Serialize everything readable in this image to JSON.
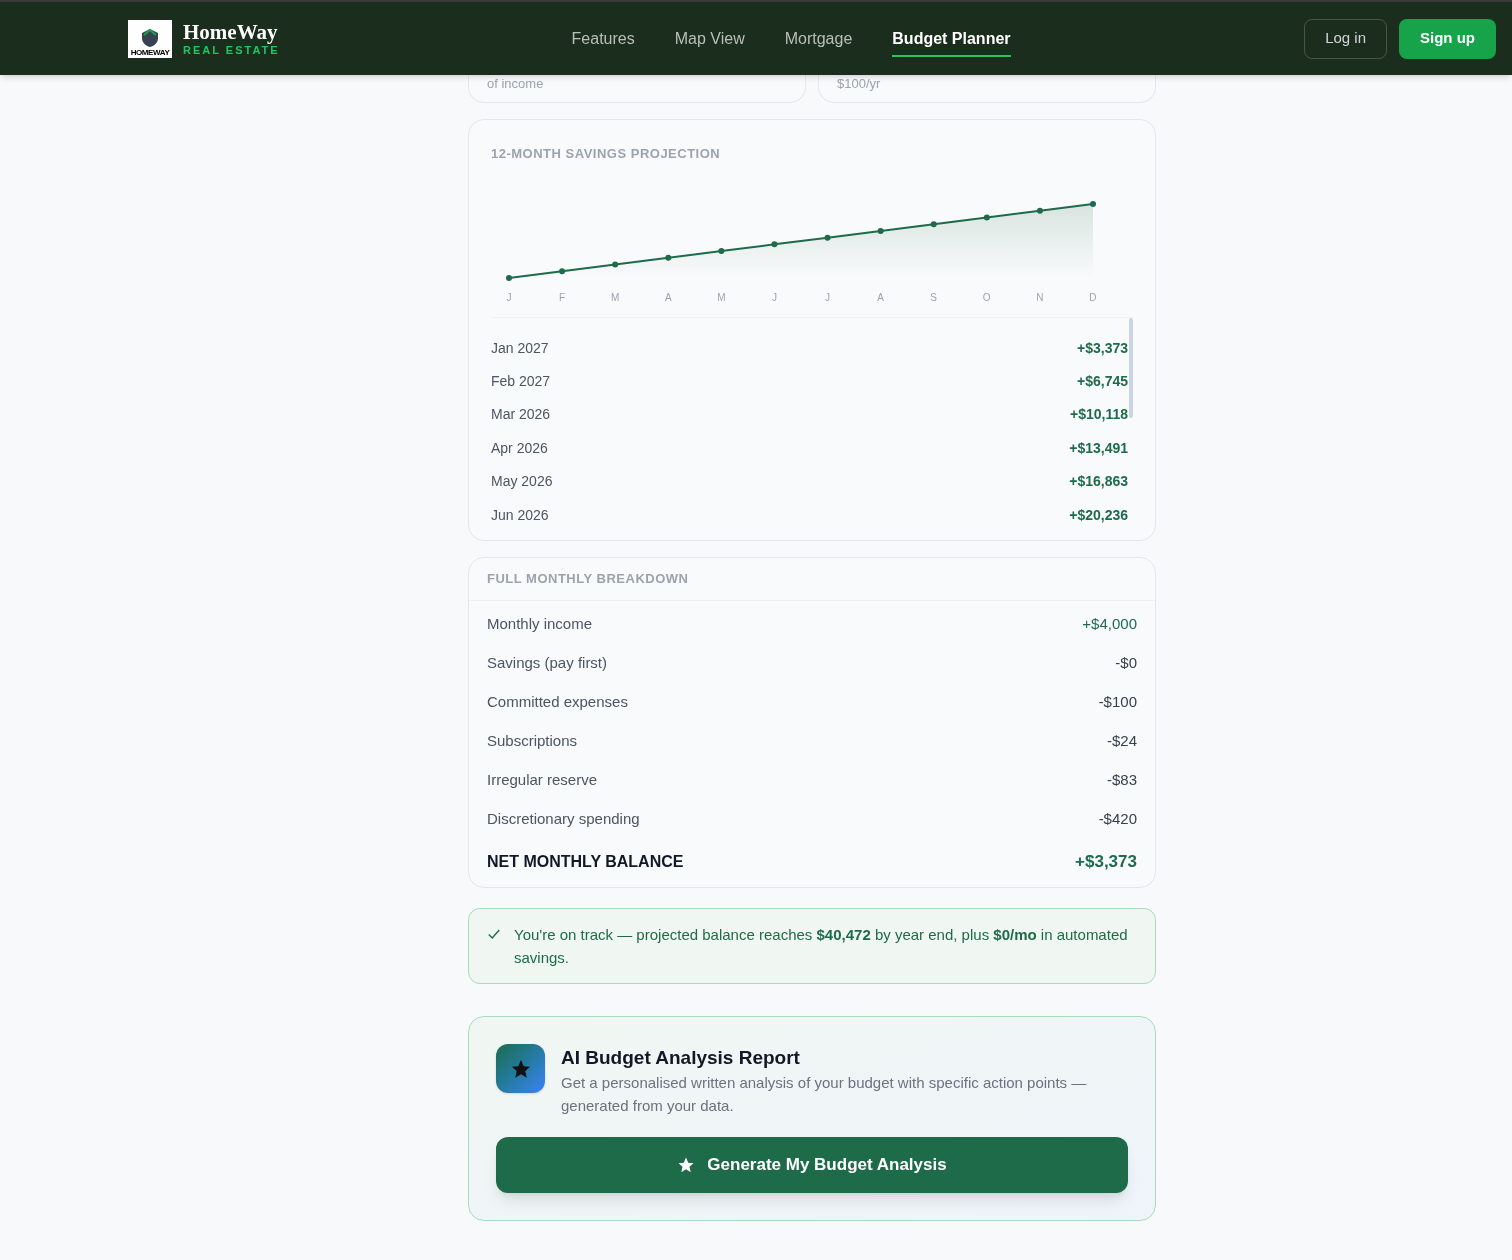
{
  "brand": {
    "name": "HomeWay",
    "tagline": "REAL ESTATE",
    "logo_caption": "HOMEWAY"
  },
  "nav": [
    {
      "label": "Features",
      "selected": false
    },
    {
      "label": "Map View",
      "selected": false
    },
    {
      "label": "Mortgage",
      "selected": false
    },
    {
      "label": "Budget Planner",
      "selected": true
    }
  ],
  "auth": {
    "login": "Log in",
    "signup": "Sign up"
  },
  "top_cards": [
    "of income",
    "$100/yr"
  ],
  "projection": {
    "title": "12-MONTH SAVINGS PROJECTION",
    "x_labels": [
      "J",
      "F",
      "M",
      "A",
      "M",
      "J",
      "J",
      "A",
      "S",
      "O",
      "N",
      "D"
    ],
    "rows": [
      {
        "month": "Jan 2027",
        "amount": "+$3,373"
      },
      {
        "month": "Feb 2027",
        "amount": "+$6,745"
      },
      {
        "month": "Mar 2026",
        "amount": "+$10,118"
      },
      {
        "month": "Apr 2026",
        "amount": "+$13,491"
      },
      {
        "month": "May 2026",
        "amount": "+$16,863"
      },
      {
        "month": "Jun 2026",
        "amount": "+$20,236"
      }
    ]
  },
  "breakdown": {
    "title": "FULL MONTHLY BREAKDOWN",
    "rows": [
      {
        "label": "Monthly income",
        "amount": "+$4,000",
        "kind": "credit"
      },
      {
        "label": "Savings (pay first)",
        "amount": "-$0",
        "kind": "debit"
      },
      {
        "label": "Committed expenses",
        "amount": "-$100",
        "kind": "debit"
      },
      {
        "label": "Subscriptions",
        "amount": "-$24",
        "kind": "debit"
      },
      {
        "label": "Irregular reserve",
        "amount": "-$83",
        "kind": "debit"
      },
      {
        "label": "Discretionary spending",
        "amount": "-$420",
        "kind": "debit"
      }
    ],
    "total": {
      "label": "NET MONTHLY BALANCE",
      "amount": "+$3,373"
    }
  },
  "status": "You're on track — projected balance reaches **$40,472** by year end, plus **$0/mo** in automated savings.",
  "ai_report": {
    "title": "AI Budget Analysis Report",
    "description": "Get a personalised written analysis of your budget with specific action points — generated from your data.",
    "button": "Generate My Budget Analysis"
  }
}
